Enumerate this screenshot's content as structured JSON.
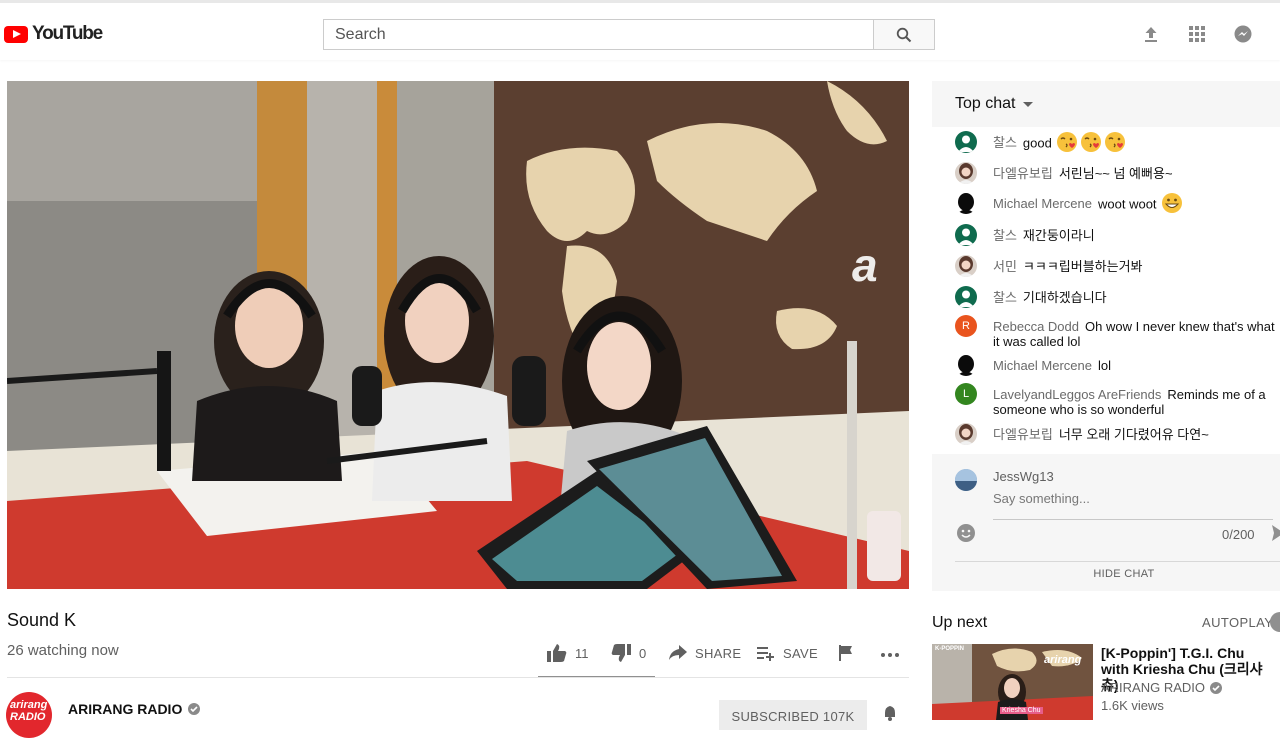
{
  "header": {
    "logo_text": "YouTube",
    "search_placeholder": "Search",
    "icons": [
      "upload-icon",
      "apps-icon",
      "messages-icon"
    ]
  },
  "video": {
    "title": "Sound K",
    "watching": "26 watching now",
    "likes": "11",
    "dislikes": "0",
    "share_label": "SHARE",
    "save_label": "SAVE"
  },
  "channel": {
    "name": "ARIRANG RADIO",
    "avatar_text": "arirang RADIO",
    "subscribe_label": "SUBSCRIBED  107K"
  },
  "chat": {
    "header": "Top chat",
    "messages": [
      {
        "author": "찰스",
        "text": "good",
        "emoji_count": 3,
        "emoji": "kiss",
        "avatar": "green-avatar"
      },
      {
        "author": "다엘유보립",
        "text": "서린님~~ 넘 예뻐용~",
        "emoji_count": 0,
        "avatar": "photo-avatar"
      },
      {
        "author": "Michael Mercene",
        "text": "woot woot",
        "emoji_count": 1,
        "emoji": "grin",
        "avatar": "silhouette-avatar"
      },
      {
        "author": "찰스",
        "text": "재간둥이라니",
        "emoji_count": 0,
        "avatar": "green-avatar"
      },
      {
        "author": "서민",
        "text": "ㅋㅋㅋ립버블하는거봐",
        "emoji_count": 0,
        "avatar": "photo-avatar"
      },
      {
        "author": "찰스",
        "text": "기대하겠습니다",
        "emoji_count": 0,
        "avatar": "green-avatar"
      },
      {
        "author": "Rebecca Dodd",
        "text": "Oh wow I never knew that's what it was called lol",
        "emoji_count": 0,
        "avatar": "letter-R-avatar",
        "initial": "R",
        "color": "#e9541e"
      },
      {
        "author": "Michael Mercene",
        "text": "lol",
        "emoji_count": 0,
        "avatar": "silhouette-avatar"
      },
      {
        "author": "LavelyandLeggos AreFriends",
        "text": "Reminds me of a someone who is so wonderful",
        "emoji_count": 0,
        "avatar": "letter-L-avatar",
        "initial": "L",
        "color": "#33861f"
      },
      {
        "author": "다엘유보립",
        "text": "너무 오래 기다렸어유 다연~",
        "emoji_count": 0,
        "avatar": "photo-avatar"
      }
    ],
    "me": "JessWg13",
    "input_placeholder": "Say something...",
    "char_count": "0/200",
    "hide_label": "HIDE CHAT"
  },
  "up_next": {
    "heading": "Up next",
    "autoplay_label": "AUTOPLAY",
    "item": {
      "title": "[K-Poppin'] T.G.I. Chu with Kriesha Chu (크리샤츄)",
      "channel": "ARIRANG RADIO",
      "views": "1.6K views",
      "thumb_label": "K-POPPIN",
      "thumb_brand": "arirang",
      "thumb_caption": "Kriesha Chu"
    }
  },
  "colors": {
    "brand_red": "#ff0000",
    "accent_green": "#0f6b4e",
    "muted_text": "#606060"
  }
}
